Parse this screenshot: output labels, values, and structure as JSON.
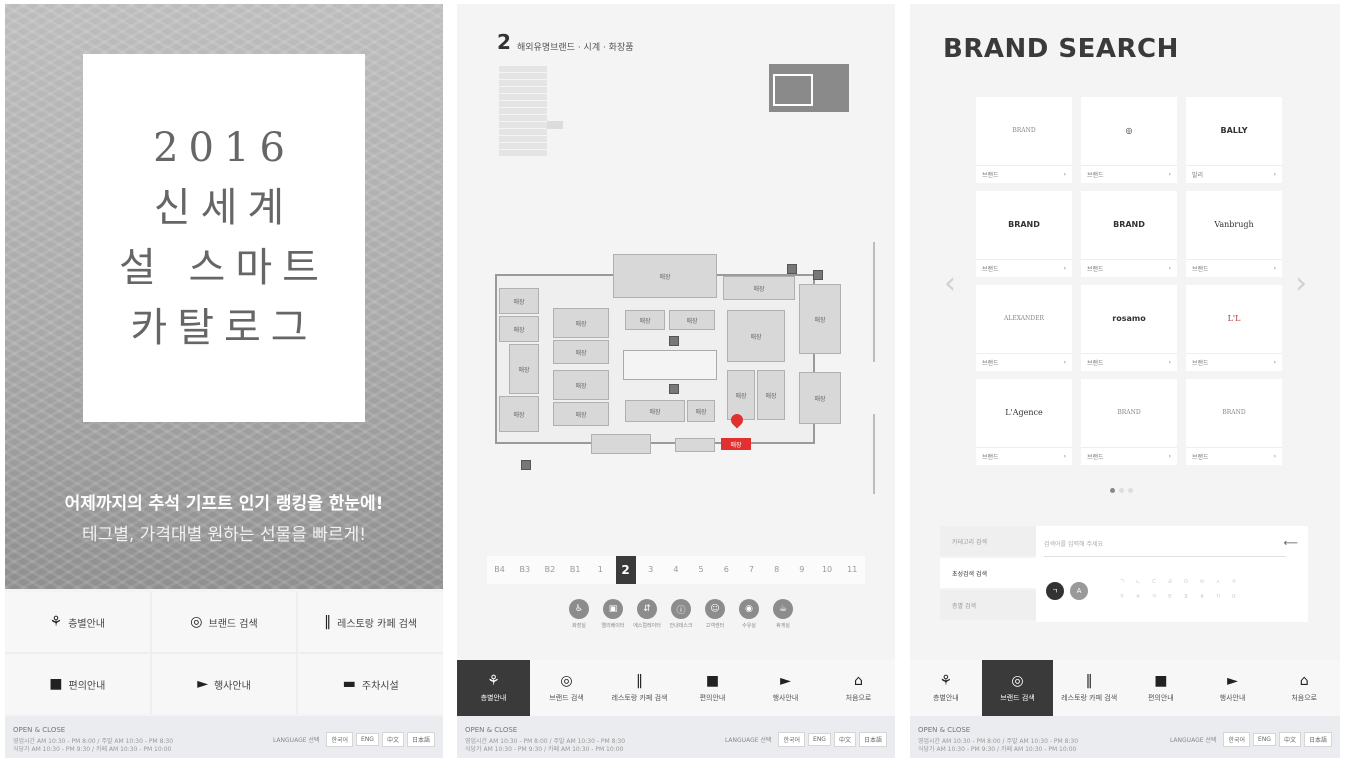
{
  "panel1": {
    "cover_lines": [
      "2016",
      "신세계",
      "설 스마트",
      "카탈로그"
    ],
    "subtitle1": "어제까지의 추석 기프트 인기 랭킹을 한눈에!",
    "subtitle2": "테그별, 가격대별 원하는 선물을 빠르게!",
    "menu": [
      {
        "icon": "⚘",
        "label": "층별안내"
      },
      {
        "icon": "◎",
        "label": "브랜드 검색"
      },
      {
        "icon": "‖",
        "label": "레스토랑 카페 검색"
      },
      {
        "icon": "■",
        "label": "편의안내"
      },
      {
        "icon": "►",
        "label": "행사안내"
      },
      {
        "icon": "▬",
        "label": "주차시설"
      }
    ]
  },
  "footer": {
    "title": "OPEN & CLOSE",
    "line1": "영업시간 AM 10:30 - PM 8:00 / 주말 AM 10:30 - PM 8:30",
    "line2": "식당가 AM 10:30 - PM 9:30 / 카페 AM 10:30 - PM 10:00",
    "lang_label": "LANGUAGE 선택",
    "langs": [
      "한국어",
      "ENG",
      "中文",
      "日本語"
    ]
  },
  "panel2": {
    "floor_number": "2",
    "floor_name": "해외유명브랜드 · 시계 · 화장품",
    "map_labels": {
      "top": "매장",
      "a": "매장",
      "b": "매장",
      "c": "매장",
      "d": "매장",
      "e": "매장",
      "f": "매장",
      "g": "매장",
      "h": "매장",
      "i": "매장",
      "j": "매장",
      "k": "매장",
      "l": "매장",
      "m": "매장",
      "n": "매장",
      "o": "매장",
      "p": "매장",
      "q": "매장",
      "r": "매장"
    },
    "highlight": "매장",
    "floors": [
      "B4",
      "B3",
      "B2",
      "B1",
      "1",
      "2",
      "3",
      "4",
      "5",
      "6",
      "7",
      "8",
      "9",
      "10",
      "11"
    ],
    "active_floor": "2",
    "facilities": [
      "화장실",
      "엘리베이터",
      "에스컬레이터",
      "안내데스크",
      "고객센터",
      "수유실",
      "휴게실"
    ],
    "facility_icons": [
      "♿",
      "▣",
      "⇵",
      "ⓘ",
      "☺",
      "◉",
      "☕"
    ]
  },
  "tabs": [
    {
      "icon": "⚘",
      "label": "층별안내"
    },
    {
      "icon": "◎",
      "label": "브랜드 검색"
    },
    {
      "icon": "‖",
      "label": "레스토랑 카페 검색"
    },
    {
      "icon": "■",
      "label": "편의안내"
    },
    {
      "icon": "►",
      "label": "행사안내"
    },
    {
      "icon": "⌂",
      "label": "처음으로"
    }
  ],
  "panel3": {
    "title": "BRAND SEARCH",
    "brands": [
      {
        "logo": "BRAND",
        "name": "브랜드"
      },
      {
        "logo": "◎",
        "name": "브랜드"
      },
      {
        "logo": "BALLY",
        "name": "발리"
      },
      {
        "logo": "BRAND",
        "name": "브랜드"
      },
      {
        "logo": "BRAND",
        "name": "브랜드"
      },
      {
        "logo": "Vanbrugh",
        "name": "브랜드"
      },
      {
        "logo": "ALEXANDER",
        "name": "브랜드"
      },
      {
        "logo": "rosamo",
        "name": "브랜드"
      },
      {
        "logo": "L'L",
        "name": "브랜드"
      },
      {
        "logo": "L'Agence",
        "name": "브랜드"
      },
      {
        "logo": "BRAND",
        "name": "브랜드"
      },
      {
        "logo": "BRAND",
        "name": "브랜드"
      }
    ],
    "arrow_left": "‹",
    "arrow_right": "›",
    "side": [
      "카테고리 검색",
      "초성검색 검색",
      "층별 검색"
    ],
    "search_placeholder": "검색어를 입력해 주세요",
    "go": "⟵",
    "btn_a": "ㄱ",
    "btn_b": "A",
    "keys": [
      "ㄱ",
      "ㄴ",
      "ㄷ",
      "ㄹ",
      "ㅁ",
      "ㅂ",
      "ㅅ",
      "ㅇ",
      "ㅈ",
      "ㅊ",
      "ㅋ",
      "ㅌ",
      "ㅍ",
      "ㅎ",
      "ㄲ",
      "ㄸ"
    ]
  }
}
